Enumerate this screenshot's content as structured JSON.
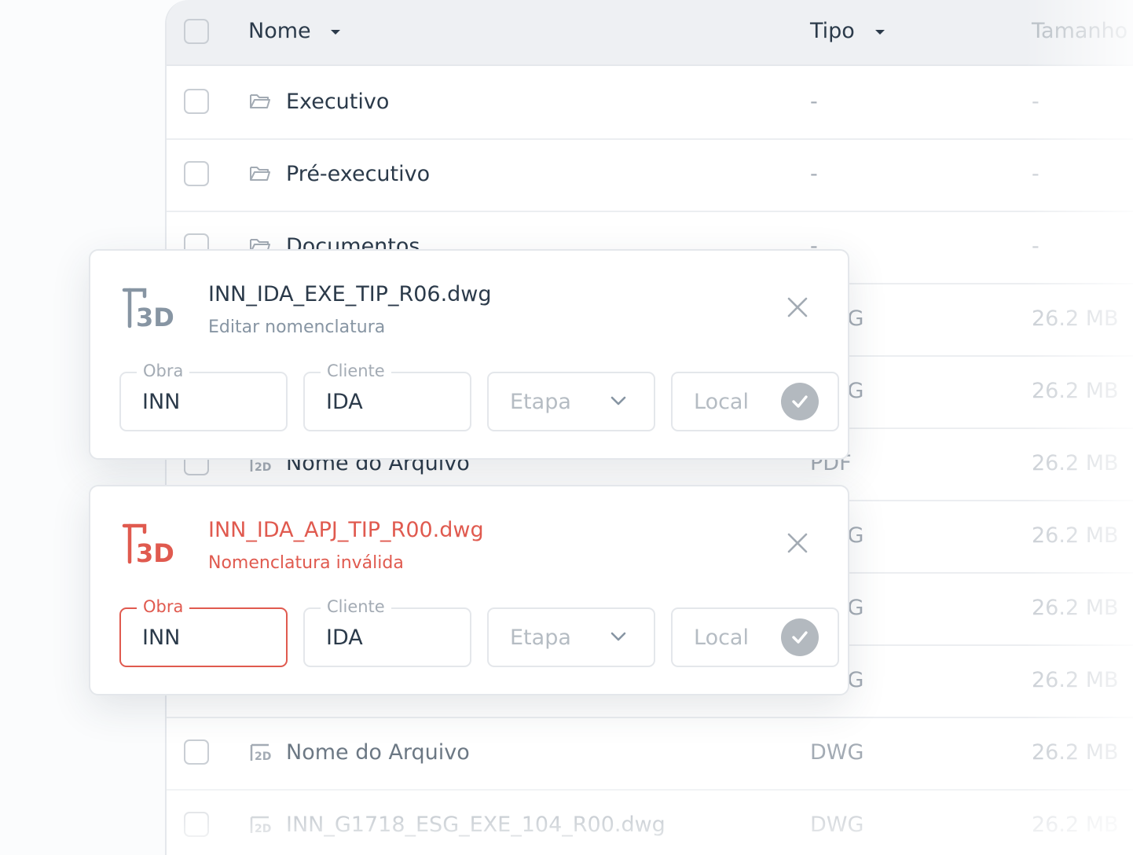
{
  "table": {
    "columns": {
      "name": "Nome",
      "type": "Tipo",
      "size": "Tamanho"
    },
    "rows": [
      {
        "name": "Executivo",
        "type": "-",
        "size": "-",
        "icon": "folder-icon"
      },
      {
        "name": "Pré-executivo",
        "type": "-",
        "size": "-",
        "icon": "folder-icon"
      },
      {
        "name": "Documentos",
        "type": "-",
        "size": "-",
        "icon": "folder-icon"
      },
      {
        "name": "",
        "type": "DWG",
        "size": "26.2 MB",
        "icon": ""
      },
      {
        "name": "",
        "type": "DWG",
        "size": "26.2 MB",
        "icon": ""
      },
      {
        "name": "Nome do Arquivo",
        "type": "PDF",
        "size": "26.2 MB",
        "icon": "file-2d-icon"
      },
      {
        "name": "",
        "type": "DWG",
        "size": "26.2 MB",
        "icon": ""
      },
      {
        "name": "",
        "type": "DWG",
        "size": "26.2 MB",
        "icon": ""
      },
      {
        "name": "",
        "type": "DWG",
        "size": "26.2 MB",
        "icon": ""
      },
      {
        "name": "Nome do Arquivo",
        "type": "DWG",
        "size": "26.2 MB",
        "icon": "file-2d-icon"
      },
      {
        "name": "INN_G1718_ESG_EXE_104_R00.dwg",
        "type": "DWG",
        "size": "26.2 MB",
        "icon": "file-2d-icon"
      }
    ]
  },
  "cards": [
    {
      "filename": "INN_IDA_EXE_TIP_R06.dwg",
      "subtitle": "Editar nomenclatura",
      "state": "normal",
      "fields": {
        "obra": {
          "label": "Obra",
          "value": "INN"
        },
        "cliente": {
          "label": "Cliente",
          "value": "IDA"
        },
        "etapa": {
          "placeholder": "Etapa"
        },
        "local": {
          "placeholder": "Local"
        }
      }
    },
    {
      "filename": "INN_IDA_APJ_TIP_R00.dwg",
      "subtitle": "Nomenclatura inválida",
      "state": "invalid",
      "fields": {
        "obra": {
          "label": "Obra",
          "value": "INN"
        },
        "cliente": {
          "label": "Cliente",
          "value": "IDA"
        },
        "etapa": {
          "placeholder": "Etapa"
        },
        "local": {
          "placeholder": "Local"
        }
      }
    }
  ],
  "colors": {
    "text": "#2b3a4a",
    "muted": "#8795a3",
    "error": "#e05a4f",
    "confirm": "#b3b9bf"
  }
}
